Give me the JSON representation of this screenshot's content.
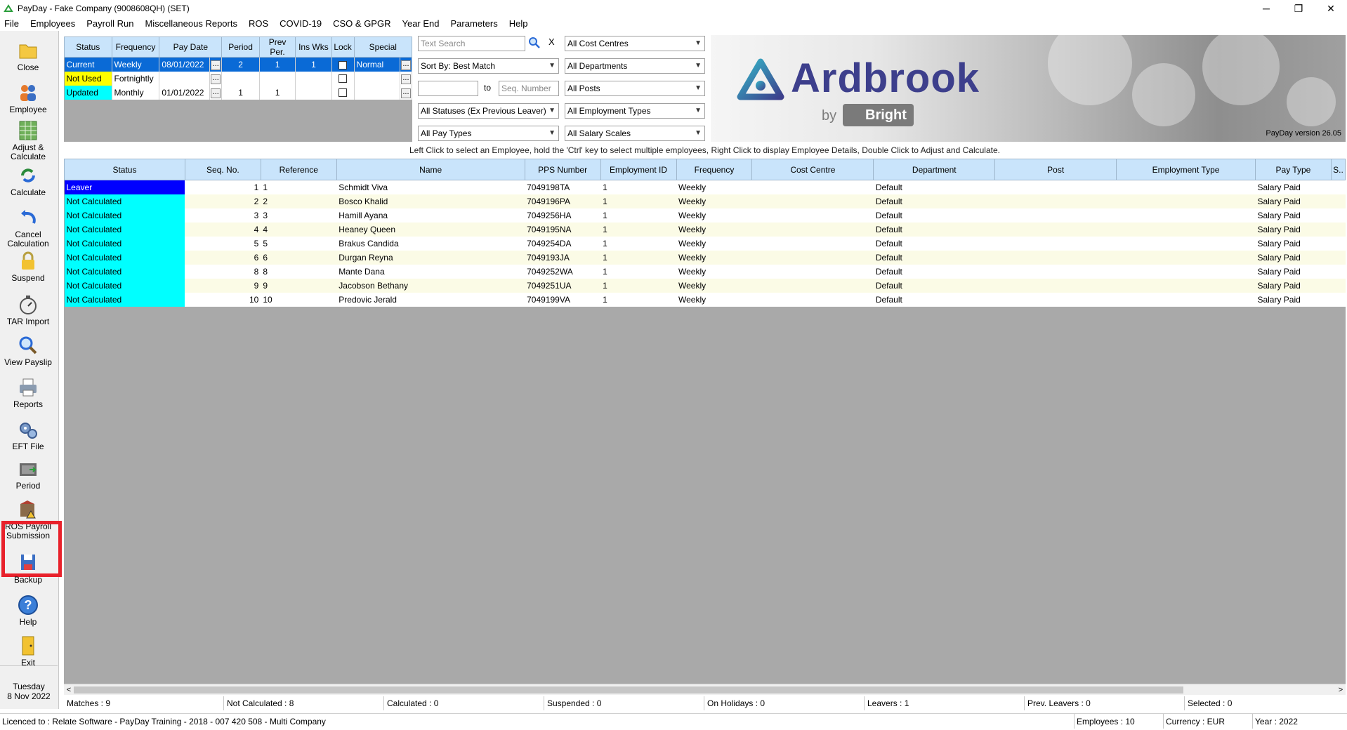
{
  "window": {
    "title": "PayDay - Fake Company (9008608QH) (SET)",
    "minimize": "─",
    "restore": "❐",
    "close": "✕"
  },
  "menu": [
    "File",
    "Employees",
    "Payroll Run",
    "Miscellaneous Reports",
    "ROS",
    "COVID-19",
    "CSO & GPGR",
    "Year End",
    "Parameters",
    "Help"
  ],
  "toolbar": [
    {
      "label": "Close",
      "icon": "folder-icon"
    },
    {
      "label": "Employee",
      "icon": "people-icon"
    },
    {
      "label": "Adjust & Calculate",
      "icon": "calculator-grid-icon"
    },
    {
      "label": "Calculate",
      "icon": "refresh-arrows-icon"
    },
    {
      "label": "Cancel Calculation",
      "icon": "undo-arrow-icon"
    },
    {
      "label": "Suspend",
      "icon": "padlock-icon"
    },
    {
      "label": "TAR Import",
      "icon": "stopwatch-icon"
    },
    {
      "label": "View Payslip",
      "icon": "magnifier-icon"
    },
    {
      "label": "Reports",
      "icon": "printer-icon"
    },
    {
      "label": "EFT File",
      "icon": "gears-icon"
    },
    {
      "label": "Period",
      "icon": "period-icon"
    },
    {
      "label": "ROS Payroll Submission",
      "icon": "ros-submit-icon"
    },
    {
      "label": "Backup",
      "icon": "save-disk-icon"
    },
    {
      "label": "Help",
      "icon": "help-icon"
    },
    {
      "label": "Exit",
      "icon": "exit-door-icon"
    }
  ],
  "date": {
    "day": "Tuesday",
    "date": "8 Nov 2022"
  },
  "period_table": {
    "headers": [
      "Status",
      "Frequency",
      "Pay Date",
      "",
      "Period",
      "Prev Per.",
      "Ins Wks",
      "Lock",
      "Special",
      ""
    ],
    "rows": [
      {
        "status": "Current",
        "frequency": "Weekly",
        "pay_date": "08/01/2022",
        "period": "2",
        "prev_per": "1",
        "ins_wks": "1",
        "special": "Normal",
        "dots": "..."
      },
      {
        "status": "Not Used",
        "frequency": "Fortnightly",
        "pay_date": "",
        "period": "",
        "prev_per": "",
        "ins_wks": "",
        "special": "",
        "dots": "..."
      },
      {
        "status": "Updated",
        "frequency": "Monthly",
        "pay_date": "01/01/2022",
        "period": "1",
        "prev_per": "1",
        "ins_wks": "",
        "special": "",
        "dots": "..."
      }
    ]
  },
  "filters": {
    "text_search_placeholder": "Text Search",
    "clear": "X",
    "sort_by": "Sort By: Best Match",
    "seq_to": "to",
    "seq_number_placeholder": "Seq. Number",
    "statuses": "All Statuses (Ex Previous Leaver)",
    "pay_types": "All Pay Types",
    "cost_centres": "All Cost Centres",
    "departments": "All Departments",
    "posts": "All Posts",
    "employment_types": "All Employment Types",
    "salary_scales": "All Salary Scales",
    "arrow": "▼"
  },
  "banner": {
    "brand": "Ardbrook",
    "by": "by",
    "bright": "Bright",
    "version": "PayDay version 26.05"
  },
  "instructions": "Left Click to select an Employee,  hold the 'Ctrl' key to select multiple employees,  Right Click to display Employee Details,  Double Click to Adjust and Calculate.",
  "grid": {
    "headers": [
      "Status",
      "Seq. No.",
      "Reference",
      "Name",
      "PPS Number",
      "Employment ID",
      "Frequency",
      "Cost Centre",
      "Department",
      "Post",
      "Employment Type",
      "Pay Type",
      "S.."
    ],
    "rows": [
      {
        "status": "Leaver",
        "seq": "1",
        "ref": "1",
        "name": "Schmidt Viva",
        "pps": "7049198TA",
        "emp_id": "1",
        "freq": "Weekly",
        "cost_centre": "",
        "dept": "Default",
        "post": "",
        "emp_type": "",
        "pay_type": "Salary Paid"
      },
      {
        "status": "Not Calculated",
        "seq": "2",
        "ref": "2",
        "name": "Bosco Khalid",
        "pps": "7049196PA",
        "emp_id": "1",
        "freq": "Weekly",
        "cost_centre": "",
        "dept": "Default",
        "post": "",
        "emp_type": "",
        "pay_type": "Salary Paid"
      },
      {
        "status": "Not Calculated",
        "seq": "3",
        "ref": "3",
        "name": "Hamill Ayana",
        "pps": "7049256HA",
        "emp_id": "1",
        "freq": "Weekly",
        "cost_centre": "",
        "dept": "Default",
        "post": "",
        "emp_type": "",
        "pay_type": "Salary Paid"
      },
      {
        "status": "Not Calculated",
        "seq": "4",
        "ref": "4",
        "name": "Heaney Queen",
        "pps": "7049195NA",
        "emp_id": "1",
        "freq": "Weekly",
        "cost_centre": "",
        "dept": "Default",
        "post": "",
        "emp_type": "",
        "pay_type": "Salary Paid"
      },
      {
        "status": "Not Calculated",
        "seq": "5",
        "ref": "5",
        "name": "Brakus Candida",
        "pps": "7049254DA",
        "emp_id": "1",
        "freq": "Weekly",
        "cost_centre": "",
        "dept": "Default",
        "post": "",
        "emp_type": "",
        "pay_type": "Salary Paid"
      },
      {
        "status": "Not Calculated",
        "seq": "6",
        "ref": "6",
        "name": "Durgan Reyna",
        "pps": "7049193JA",
        "emp_id": "1",
        "freq": "Weekly",
        "cost_centre": "",
        "dept": "Default",
        "post": "",
        "emp_type": "",
        "pay_type": "Salary Paid"
      },
      {
        "status": "Not Calculated",
        "seq": "8",
        "ref": "8",
        "name": "Mante Dana",
        "pps": "7049252WA",
        "emp_id": "1",
        "freq": "Weekly",
        "cost_centre": "",
        "dept": "Default",
        "post": "",
        "emp_type": "",
        "pay_type": "Salary Paid"
      },
      {
        "status": "Not Calculated",
        "seq": "9",
        "ref": "9",
        "name": "Jacobson Bethany",
        "pps": "7049251UA",
        "emp_id": "1",
        "freq": "Weekly",
        "cost_centre": "",
        "dept": "Default",
        "post": "",
        "emp_type": "",
        "pay_type": "Salary Paid"
      },
      {
        "status": "Not Calculated",
        "seq": "10",
        "ref": "10",
        "name": "Predovic Jerald",
        "pps": "7049199VA",
        "emp_id": "1",
        "freq": "Weekly",
        "cost_centre": "",
        "dept": "Default",
        "post": "",
        "emp_type": "",
        "pay_type": "Salary Paid"
      }
    ]
  },
  "scroll": {
    "left": "<",
    "right": ">"
  },
  "status_counts": {
    "matches": "Matches : 9",
    "not_calculated": "Not Calculated : 8",
    "calculated": "Calculated : 0",
    "suspended": "Suspended : 0",
    "on_holidays": "On Holidays : 0",
    "leavers": "Leavers : 1",
    "prev_leavers": "Prev. Leavers : 0",
    "selected": "Selected : 0"
  },
  "footer": {
    "licence": "Licenced to : Relate Software - PayDay Training - 2018 - 007 420 508 - Multi Company",
    "employees": "Employees : 10",
    "currency": "Currency : EUR",
    "year": "Year : 2022"
  },
  "colors": {
    "header_blue": "#c9e4fb",
    "selected_blue": "#0a6ad6",
    "leaver_blue": "#0000ff",
    "not_calc_cyan": "#00ffff",
    "highlight_red": "#e8212b",
    "brand_purple": "#3d3f8c"
  }
}
